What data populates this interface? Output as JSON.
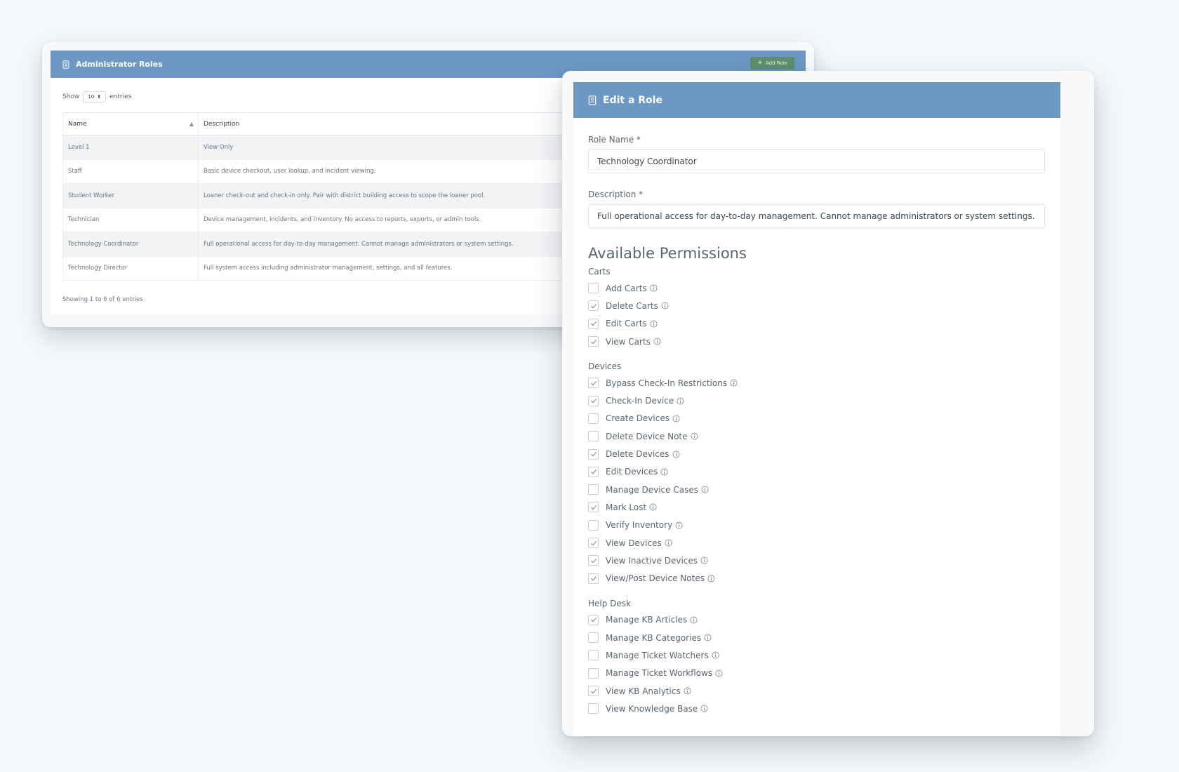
{
  "roles_window": {
    "title": "Administrator Roles",
    "add_button": "Add Role",
    "show_label": "Show",
    "entries_value": "10",
    "entries_label": "entries",
    "columns": [
      "Name",
      "Description"
    ],
    "rows": [
      {
        "name": "Level 1",
        "description": "View Only"
      },
      {
        "name": "Staff",
        "description": "Basic device checkout, user lookup, and incident viewing."
      },
      {
        "name": "Student Worker",
        "description": "Loaner check-out and check-in only. Pair with district building access to scope the loaner pool."
      },
      {
        "name": "Technician",
        "description": "Device management, incidents, and inventory. No access to reports, exports, or admin tools."
      },
      {
        "name": "Technology Coordinator",
        "description": "Full operational access for day-to-day management. Cannot manage administrators or system settings."
      },
      {
        "name": "Technology Director",
        "description": "Full system access including administrator management, settings, and all features."
      }
    ],
    "showing_text": "Showing 1 to 6 of 6 entries"
  },
  "edit_window": {
    "title": "Edit a Role",
    "role_name_label": "Role Name *",
    "role_name_value": "Technology Coordinator",
    "description_label": "Description *",
    "description_value": "Full operational access for day-to-day management. Cannot manage administrators or system settings.",
    "permissions_title": "Available Permissions",
    "groups": [
      {
        "name": "Carts",
        "items": [
          {
            "label": "Add Carts",
            "checked": false
          },
          {
            "label": "Delete Carts",
            "checked": true
          },
          {
            "label": "Edit Carts",
            "checked": true
          },
          {
            "label": "View Carts",
            "checked": true
          }
        ]
      },
      {
        "name": "Devices",
        "items": [
          {
            "label": "Bypass Check-In Restrictions",
            "checked": true
          },
          {
            "label": "Check-In Device",
            "checked": true
          },
          {
            "label": "Create Devices",
            "checked": false
          },
          {
            "label": "Delete Device Note",
            "checked": false
          },
          {
            "label": "Delete Devices",
            "checked": true
          },
          {
            "label": "Edit Devices",
            "checked": true
          },
          {
            "label": "Manage Device Cases",
            "checked": false
          },
          {
            "label": "Mark Lost",
            "checked": true
          },
          {
            "label": "Verify Inventory",
            "checked": false
          },
          {
            "label": "View Devices",
            "checked": true
          },
          {
            "label": "View Inactive Devices",
            "checked": true
          },
          {
            "label": "View/Post Device Notes",
            "checked": true
          }
        ]
      },
      {
        "name": "Help Desk",
        "items": [
          {
            "label": "Manage KB Articles",
            "checked": true
          },
          {
            "label": "Manage KB Categories",
            "checked": false
          },
          {
            "label": "Manage Ticket Watchers",
            "checked": false
          },
          {
            "label": "Manage Ticket Workflows",
            "checked": false
          },
          {
            "label": "View KB Analytics",
            "checked": true
          },
          {
            "label": "View Knowledge Base",
            "checked": false
          }
        ]
      }
    ]
  },
  "icons": {
    "header_icon": "id-badge-icon",
    "info_icon": "info-icon",
    "check_icon": "check-icon",
    "sort_icon": "sort-asc-icon",
    "plus_icon": "plus-icon"
  },
  "colors": {
    "header_blue": "#6c98c3",
    "add_button_green": "#5d8f6e"
  }
}
